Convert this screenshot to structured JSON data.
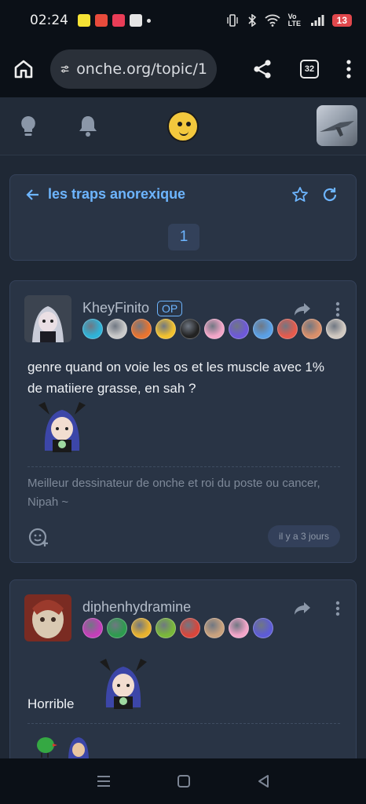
{
  "status": {
    "time": "02:24",
    "battery": "13",
    "network": "Vo LTE"
  },
  "browser": {
    "url": "onche.org/topic/1",
    "tab_count": "32"
  },
  "topic": {
    "title": "les traps anorexique",
    "page": "1"
  },
  "posts": [
    {
      "username": "KheyFinito",
      "op_label": "OP",
      "body": "genre quand on voie les os et les muscle avec 1% de matiiere grasse, en sah ?",
      "signature": "Meilleur dessinateur de onche et roi du poste ou cancer, Nipah ~",
      "time": "il y a 3 jours",
      "badge_colors": [
        "#2fb3d8",
        "#c9c9c9",
        "#e9742f",
        "#f2c12e",
        "#222222",
        "#f3a6c8",
        "#6e59d9",
        "#5aa0e6",
        "#e65b4d",
        "#d98f6a",
        "#d0c8c0"
      ]
    },
    {
      "username": "diphenhydramine",
      "body": "Horrible",
      "badge_colors": [
        "#c43fb9",
        "#2e9b4f",
        "#e8b22e",
        "#7ab83a",
        "#d9463b",
        "#c9a27e",
        "#f2a5c9",
        "#5d5cd6"
      ]
    }
  ],
  "icons": [
    "home-icon",
    "tune-icon",
    "share-icon",
    "more-icon",
    "lightbulb-icon",
    "bell-icon",
    "star-icon",
    "refresh-icon",
    "back-arrow-icon",
    "reply-icon",
    "add-reaction-icon"
  ]
}
